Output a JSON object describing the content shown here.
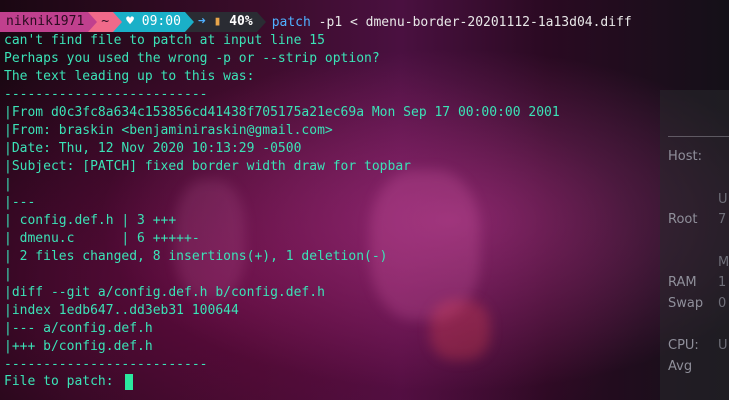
{
  "prompt": {
    "user": "niknik1971",
    "tilde": "~",
    "clock_icon": "heart-icon",
    "time": "09:00",
    "battery_icon": "battery-icon",
    "battery": "40%",
    "command": "patch",
    "args": " -p1 < dmenu-border-20201112-1a13d04.diff"
  },
  "output": [
    "can't find file to patch at input line 15",
    "Perhaps you used the wrong -p or --strip option?",
    "The text leading up to this was:",
    "--------------------------",
    "|From d0c3fc8a634c153856cd41438f705175a21ec69a Mon Sep 17 00:00:00 2001",
    "|From: braskin <benjaminiraskin@gmail.com>",
    "|Date: Thu, 12 Nov 2020 10:13:29 -0500",
    "|Subject: [PATCH] fixed border width draw for topbar",
    "|",
    "|---",
    "| config.def.h | 3 +++",
    "| dmenu.c      | 6 +++++-",
    "| 2 files changed, 8 insertions(+), 1 deletion(-)",
    "|",
    "|diff --git a/config.def.h b/config.def.h",
    "|index 1edb647..dd3eb31 100644",
    "|--- a/config.def.h",
    "|+++ b/config.def.h",
    "--------------------------"
  ],
  "input_prompt": "File to patch: ",
  "colors": {
    "user_bg": "#c0408e",
    "tilde_bg": "#f06a8a",
    "time_bg": "#1ab0c8",
    "battery_bg": "#2a2c33",
    "text": "#3be3b7"
  },
  "widget": {
    "host_label": "Host:",
    "root_label": "Root",
    "root_value": "7",
    "u1": "U",
    "u2": "U",
    "m": "M",
    "ram_label": "RAM",
    "ram_value": "1",
    "swap_label": "Swap",
    "swap_value": "0",
    "cpu_label": "CPU:",
    "cpu_value": "U",
    "avg_label": "Avg"
  }
}
